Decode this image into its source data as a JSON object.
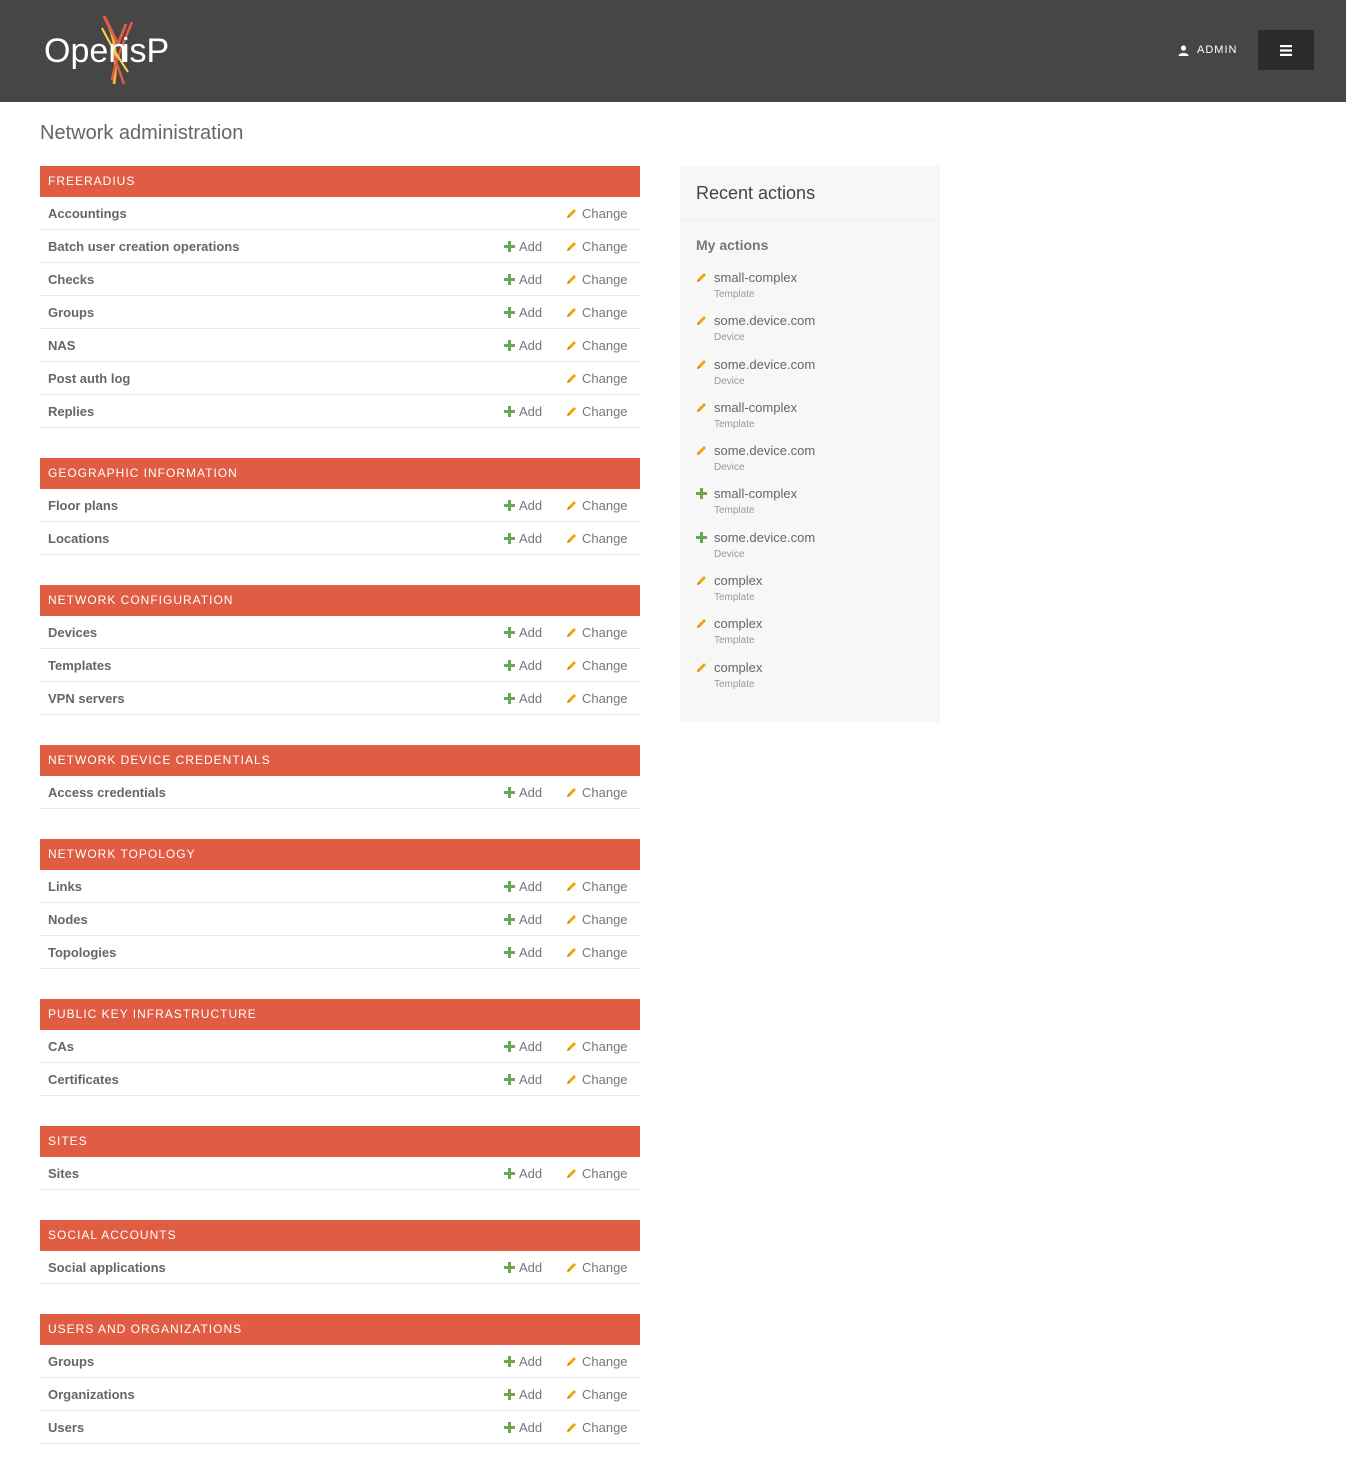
{
  "header": {
    "logo_text": "OpenWISP",
    "user_label": "ADMIN",
    "menu_icon": "hamburger-icon"
  },
  "page": {
    "title": "Network administration"
  },
  "colors": {
    "header_bg": "#464646",
    "module_header": "#e05d44",
    "add_icon": "#6aa84f",
    "change_icon": "#f0a30a"
  },
  "labels": {
    "add": "Add",
    "change": "Change"
  },
  "modules": [
    {
      "name": "FREERADIUS",
      "models": [
        {
          "name": "Accountings",
          "add": false,
          "change": true
        },
        {
          "name": "Batch user creation operations",
          "add": true,
          "change": true
        },
        {
          "name": "Checks",
          "add": true,
          "change": true
        },
        {
          "name": "Groups",
          "add": true,
          "change": true
        },
        {
          "name": "NAS",
          "add": true,
          "change": true
        },
        {
          "name": "Post auth log",
          "add": false,
          "change": true
        },
        {
          "name": "Replies",
          "add": true,
          "change": true
        }
      ]
    },
    {
      "name": "GEOGRAPHIC INFORMATION",
      "models": [
        {
          "name": "Floor plans",
          "add": true,
          "change": true
        },
        {
          "name": "Locations",
          "add": true,
          "change": true
        }
      ]
    },
    {
      "name": "NETWORK CONFIGURATION",
      "models": [
        {
          "name": "Devices",
          "add": true,
          "change": true
        },
        {
          "name": "Templates",
          "add": true,
          "change": true
        },
        {
          "name": "VPN servers",
          "add": true,
          "change": true
        }
      ]
    },
    {
      "name": "NETWORK DEVICE CREDENTIALS",
      "models": [
        {
          "name": "Access credentials",
          "add": true,
          "change": true
        }
      ]
    },
    {
      "name": "NETWORK TOPOLOGY",
      "models": [
        {
          "name": "Links",
          "add": true,
          "change": true
        },
        {
          "name": "Nodes",
          "add": true,
          "change": true
        },
        {
          "name": "Topologies",
          "add": true,
          "change": true
        }
      ]
    },
    {
      "name": "PUBLIC KEY INFRASTRUCTURE",
      "models": [
        {
          "name": "CAs",
          "add": true,
          "change": true
        },
        {
          "name": "Certificates",
          "add": true,
          "change": true
        }
      ]
    },
    {
      "name": "SITES",
      "models": [
        {
          "name": "Sites",
          "add": true,
          "change": true
        }
      ]
    },
    {
      "name": "SOCIAL ACCOUNTS",
      "models": [
        {
          "name": "Social applications",
          "add": true,
          "change": true
        }
      ]
    },
    {
      "name": "USERS AND ORGANIZATIONS",
      "models": [
        {
          "name": "Groups",
          "add": true,
          "change": true
        },
        {
          "name": "Organizations",
          "add": true,
          "change": true
        },
        {
          "name": "Users",
          "add": true,
          "change": true
        }
      ]
    }
  ],
  "recent": {
    "title": "Recent actions",
    "subtitle": "My actions",
    "items": [
      {
        "name": "small-complex",
        "type": "Template",
        "action": "change"
      },
      {
        "name": "some.device.com",
        "type": "Device",
        "action": "change"
      },
      {
        "name": "some.device.com",
        "type": "Device",
        "action": "change"
      },
      {
        "name": "small-complex",
        "type": "Template",
        "action": "change"
      },
      {
        "name": "some.device.com",
        "type": "Device",
        "action": "change"
      },
      {
        "name": "small-complex",
        "type": "Template",
        "action": "add"
      },
      {
        "name": "some.device.com",
        "type": "Device",
        "action": "add"
      },
      {
        "name": "complex",
        "type": "Template",
        "action": "change"
      },
      {
        "name": "complex",
        "type": "Template",
        "action": "change"
      },
      {
        "name": "complex",
        "type": "Template",
        "action": "change"
      }
    ]
  }
}
